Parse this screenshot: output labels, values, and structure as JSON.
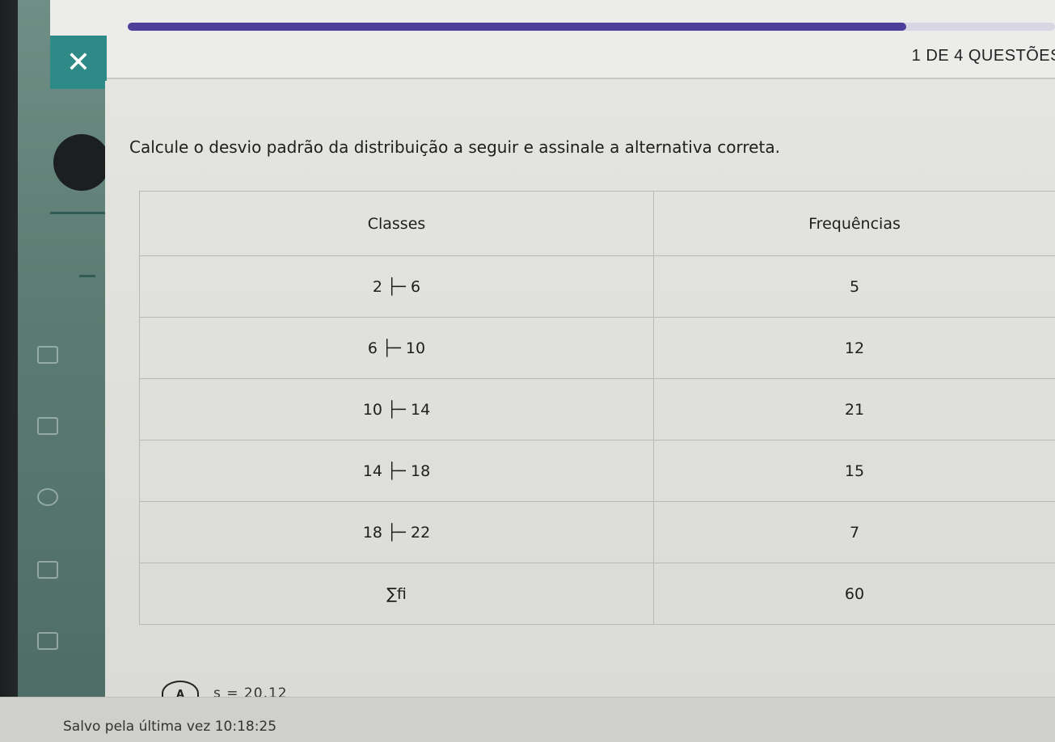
{
  "header": {
    "close_glyph": "✕",
    "question_counter": "1 DE 4 QUESTÕES",
    "progress_fraction": 0.84
  },
  "question": {
    "prompt": "Calcule o desvio padrão da distribuição a seguir e assinale a alternativa correta.",
    "table": {
      "headers": [
        "Classes",
        "Frequências"
      ],
      "rows": [
        [
          "2 ├─ 6",
          "5"
        ],
        [
          "6 ├─ 10",
          "12"
        ],
        [
          "10 ├─ 14",
          "21"
        ],
        [
          "14 ├─ 18",
          "15"
        ],
        [
          "18 ├─ 22",
          "7"
        ],
        [
          "∑fi",
          "60"
        ]
      ]
    }
  },
  "options": [
    {
      "letter": "A",
      "text": "s = 20,12"
    }
  ],
  "footer": {
    "saved_label": "Salvo pela última vez 10:18:25"
  },
  "colors": {
    "progress": "#4b3f9a",
    "close_button": "#2e8a86",
    "sidebar": "#5d7d74"
  },
  "icons": [
    "close-icon"
  ]
}
